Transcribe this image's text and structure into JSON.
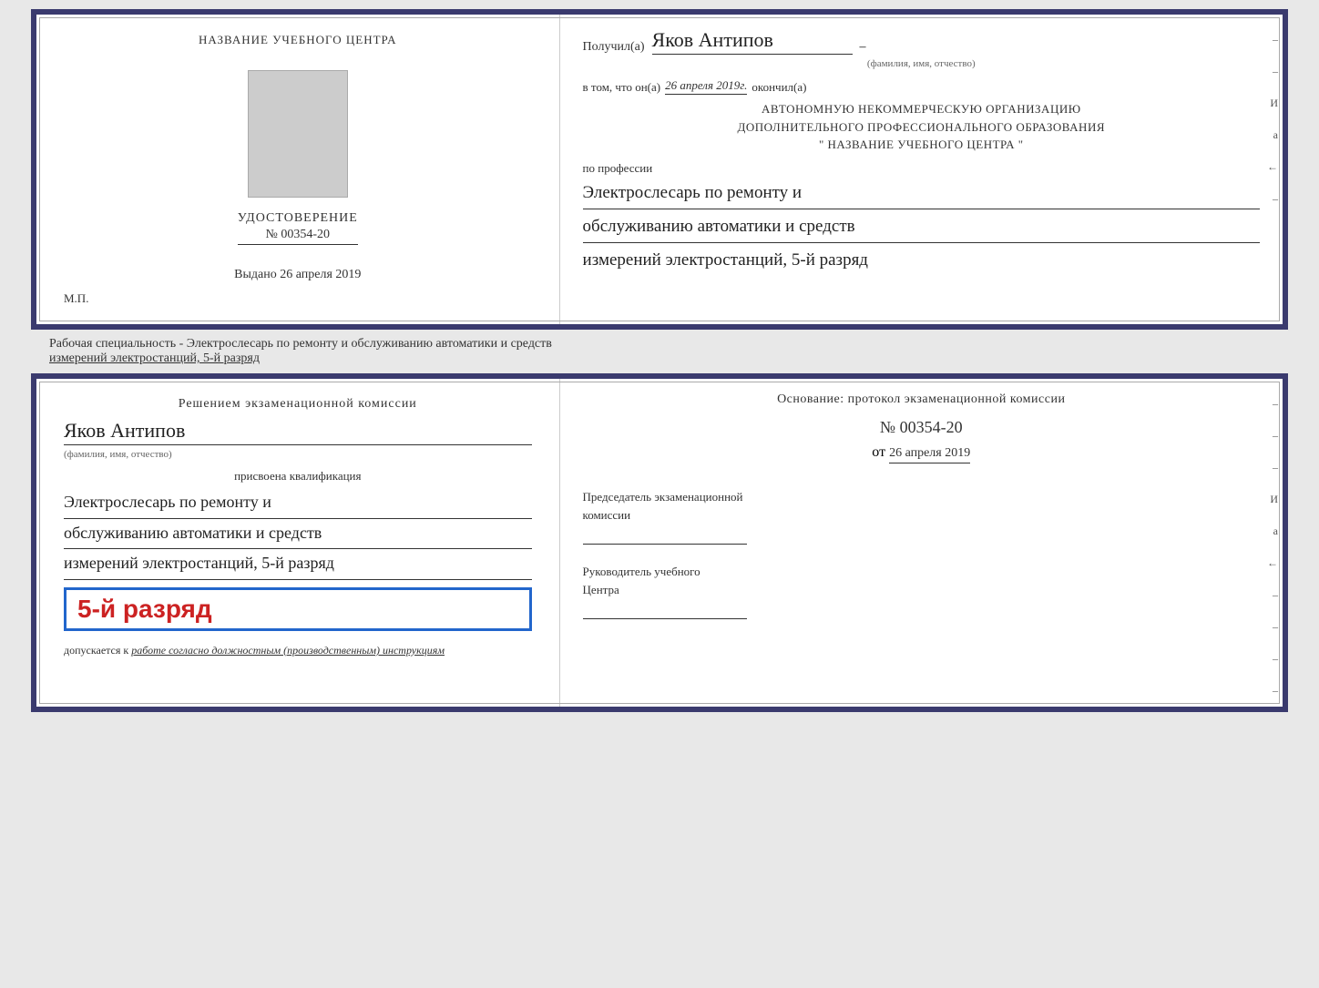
{
  "topCert": {
    "left": {
      "schoolName": "НАЗВАНИЕ УЧЕБНОГО ЦЕНТРА",
      "certTitle": "УДОСТОВЕРЕНИЕ",
      "certNumber": "№ 00354-20",
      "issuedLabel": "Выдано",
      "issuedDate": "26 апреля 2019",
      "mpLabel": "М.П."
    },
    "right": {
      "recipientLabel": "Получил(а)",
      "recipientName": "Яков Антипов",
      "recipientSubLabel": "(фамилия, имя, отчество)",
      "vtomLabel": "в том, что он(а)",
      "vtomDate": "26 апреля 2019г.",
      "okonchilLabel": "окончил(а)",
      "orgLine1": "АВТОНОМНУЮ НЕКОММЕРЧЕСКУЮ ОРГАНИЗАЦИЮ",
      "orgLine2": "ДОПОЛНИТЕЛЬНОГО ПРОФЕССИОНАЛЬНОГО ОБРАЗОВАНИЯ",
      "orgLine3": "\" НАЗВАНИЕ УЧЕБНОГО ЦЕНТРА \"",
      "poProfessiiLabel": "по профессии",
      "profession1": "Электрослесарь по ремонту и",
      "profession2": "обслуживанию автоматики и средств",
      "profession3": "измерений электростанций, 5-й разряд"
    }
  },
  "middleText": {
    "line1": "Рабочая специальность - Электрослесарь по ремонту и обслуживанию автоматики и средств",
    "line2": "измерений электростанций, 5-й разряд"
  },
  "bottomCert": {
    "left": {
      "resheniemTitle": "Решением экзаменационной комиссии",
      "recipientName": "Яков Антипов",
      "recipientSubLabel": "(фамилия, имя, отчество)",
      "prisvoenaLabel": "присвоена квалификация",
      "profession1": "Электрослесарь по ремонту и",
      "profession2": "обслуживанию автоматики и средств",
      "profession3": "измерений электростанций, 5-й разряд",
      "razryadBadge": "5-й разряд",
      "dopuskaetsyaLabel": "допускается к",
      "dopuskaetsyaText": "работе согласно должностным (производственным) инструкциям"
    },
    "right": {
      "osnovanieTitleLine1": "Основание: протокол экзаменационной комиссии",
      "protocolNumber": "№ 00354-20",
      "otLabel": "от",
      "otDate": "26 апреля 2019",
      "predsedatelLabel": "Председатель экзаменационной",
      "komissiiLabel": "комиссии",
      "rukovoditelLabel": "Руководитель учебного",
      "tsentraLabel": "Центра"
    }
  },
  "vertLabels": {
    "i1": "И",
    "a1": "а",
    "arrow1": "←",
    "dash1": "–",
    "dash2": "–",
    "dash3": "–",
    "dash4": "–",
    "dash5": "–",
    "dash6": "–",
    "dash7": "–",
    "dash8": "–"
  }
}
